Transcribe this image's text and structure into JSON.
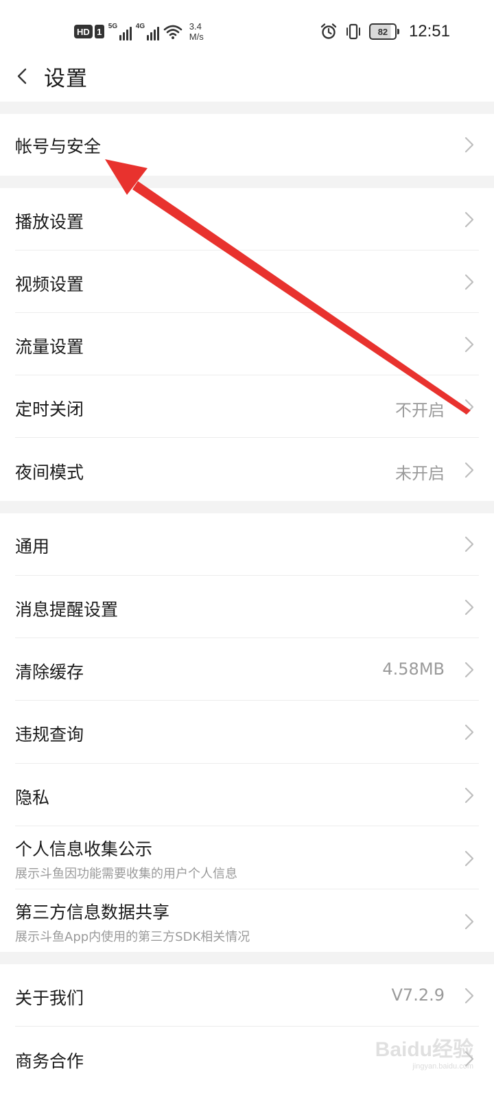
{
  "status_bar": {
    "hd_label": "HD",
    "sim_label": "1",
    "signal1_label": "5G",
    "signal2_label": "4G",
    "net_speed_value": "3.4",
    "net_speed_unit": "M/s",
    "battery_level": "82",
    "battery_fraction": 0.82,
    "time": "12:51",
    "icons": [
      "wifi-icon",
      "alarm-icon",
      "vibrate-icon"
    ]
  },
  "header": {
    "back_icon": "chevron-left-icon",
    "title": "设置"
  },
  "list": {
    "account_security": {
      "label": "帐号与安全"
    },
    "playback_settings": {
      "label": "播放设置"
    },
    "video_settings": {
      "label": "视频设置"
    },
    "traffic_settings": {
      "label": "流量设置"
    },
    "timer_off": {
      "label": "定时关闭",
      "value": "不开启"
    },
    "night_mode": {
      "label": "夜间模式",
      "value": "未开启"
    },
    "general": {
      "label": "通用"
    },
    "message_reminder": {
      "label": "消息提醒设置"
    },
    "clear_cache": {
      "label": "清除缓存",
      "value": "4.58MB"
    },
    "violation_query": {
      "label": "违规查询"
    },
    "privacy": {
      "label": "隐私"
    },
    "personal_info": {
      "label": "个人信息收集公示",
      "sub": "展示斗鱼因功能需要收集的用户个人信息"
    },
    "third_party": {
      "label": "第三方信息数据共享",
      "sub": "展示斗鱼App内使用的第三方SDK相关情况"
    },
    "about_us": {
      "label": "关于我们",
      "value": "V7.2.9"
    },
    "business": {
      "label": "商务合作"
    }
  },
  "annotation": {
    "arrow_color": "#e8322e"
  },
  "watermark": {
    "logo": "Baidu经验",
    "url": "jingyan.baidu.com"
  },
  "colors": {
    "section_gap": "#f3f3f3",
    "secondary_text": "#9a9a9a",
    "chevron": "#bdbdbd"
  }
}
